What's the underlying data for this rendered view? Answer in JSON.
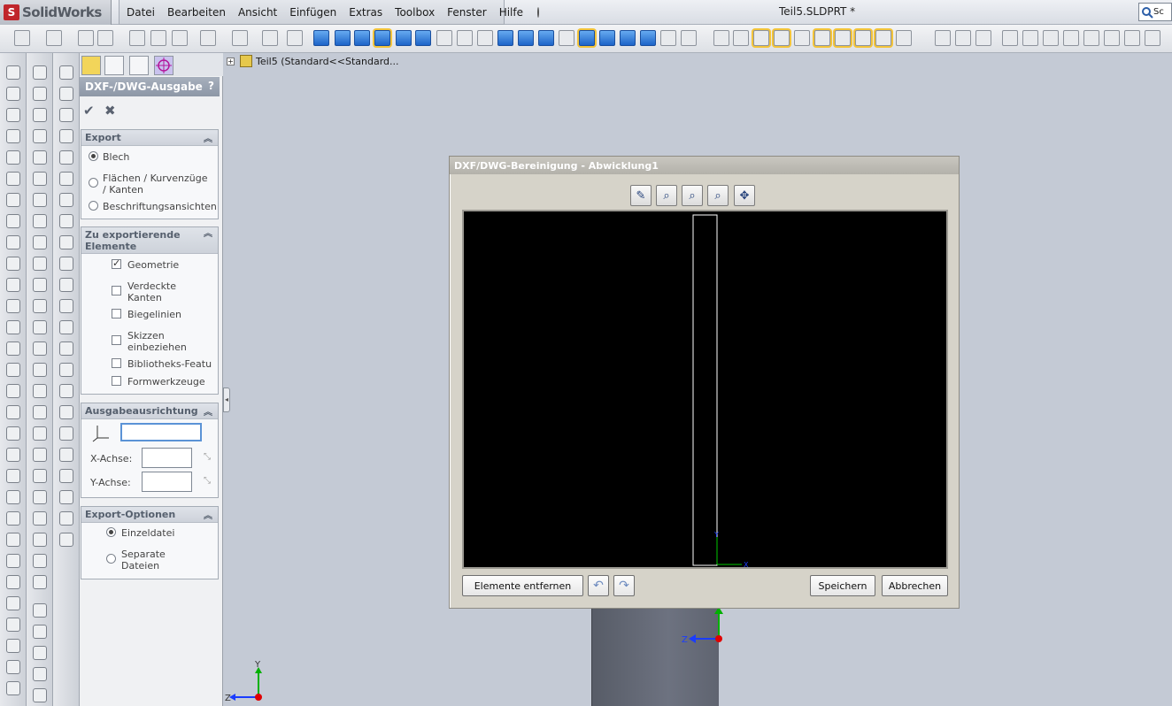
{
  "app": {
    "logo_text": "SolidWorks",
    "logo_mark": "S",
    "document_title": "Teil5.SLDPRT *",
    "search_text": "Sc"
  },
  "menu": [
    "Datei",
    "Bearbeiten",
    "Ansicht",
    "Einfügen",
    "Extras",
    "Toolbox",
    "Fenster",
    "Hilfe"
  ],
  "feature_tree": {
    "expander": "+",
    "item": "Teil5  (Standard<<Standard..."
  },
  "property_manager": {
    "title": "DXF-/DWG-Ausgabe",
    "help": "?",
    "ok": "✔",
    "cancel": "✖",
    "export": {
      "header": "Export",
      "options": [
        "Blech",
        "Flächen / Kurvenzüge / Kanten",
        "Beschriftungsansichten"
      ],
      "selected": "Blech"
    },
    "elements": {
      "header": "Zu exportierende Elemente",
      "items": [
        {
          "label": "Geometrie",
          "checked": true
        },
        {
          "label": "Verdeckte Kanten",
          "checked": false
        },
        {
          "label": "Biegelinien",
          "checked": false
        },
        {
          "label": "Skizzen einbeziehen",
          "checked": false
        },
        {
          "label": "Bibliotheks-Featu",
          "checked": false
        },
        {
          "label": "Formwerkzeuge",
          "checked": false
        }
      ]
    },
    "orientation": {
      "header": "Ausgabeausrichtung",
      "x_label": "X-Achse:",
      "y_label": "Y-Achse:",
      "x_value": "",
      "y_value": "",
      "face_value": ""
    },
    "export_options": {
      "header": "Export-Optionen",
      "options": [
        "Einzeldatei",
        "Separate Dateien"
      ],
      "selected": "Einzeldatei"
    }
  },
  "dialog": {
    "title": "DXF/DWG-Bereinigung - Abwicklung1",
    "remove_button": "Elemente entfernen",
    "save_button": "Speichern",
    "cancel_button": "Abbrechen",
    "tools": [
      "pan-zoom-icon",
      "zoom-fit-icon",
      "zoom-area-icon",
      "zoom-inout-icon",
      "pan-icon"
    ]
  },
  "triad": {
    "x": "X",
    "y": "Y",
    "z": "Z"
  },
  "colors": {
    "canvas_bg": "#000000",
    "outline": "#ffffff",
    "axis_green": "#00c800",
    "axis_blue": "#1a3cff",
    "axis_red": "#e00000"
  }
}
